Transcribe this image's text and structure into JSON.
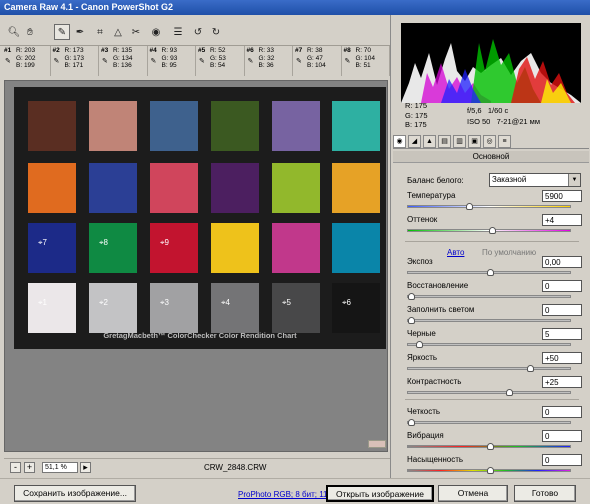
{
  "window": {
    "title": "Camera Raw 4.1  -  Canon PowerShot G2"
  },
  "toolbar": {
    "tools": [
      {
        "name": "zoom-tool-icon",
        "glyph": "🔍︎",
        "active": false
      },
      {
        "name": "hand-tool-icon",
        "glyph": "✋︎",
        "active": false
      },
      {
        "name": "white-balance-tool-icon",
        "glyph": "✎",
        "active": true
      },
      {
        "name": "color-sampler-tool-icon",
        "glyph": "✒",
        "active": false
      },
      {
        "name": "crop-tool-icon",
        "glyph": "⌗",
        "active": false
      },
      {
        "name": "straighten-tool-icon",
        "glyph": "△",
        "active": false
      },
      {
        "name": "retouch-tool-icon",
        "glyph": "✂",
        "active": false
      },
      {
        "name": "red-eye-tool-icon",
        "glyph": "◉",
        "active": false
      },
      {
        "name": "preferences-icon",
        "glyph": "☰",
        "active": false
      },
      {
        "name": "rotate-left-icon",
        "glyph": "↺",
        "active": false
      },
      {
        "name": "rotate-right-icon",
        "glyph": "↻",
        "active": false
      }
    ]
  },
  "samplers": [
    {
      "num": "#1",
      "r": "R: 203",
      "g": "G: 202",
      "b": "B: 199"
    },
    {
      "num": "#2",
      "r": "R: 173",
      "g": "G: 173",
      "b": "B: 171"
    },
    {
      "num": "#3",
      "r": "R: 135",
      "g": "G: 134",
      "b": "B: 136"
    },
    {
      "num": "#4",
      "r": "R:  93",
      "g": "G:  93",
      "b": "B:  95"
    },
    {
      "num": "#5",
      "r": "R:  52",
      "g": "G:  53",
      "b": "B:  54"
    },
    {
      "num": "#6",
      "r": "R:  33",
      "g": "G:  32",
      "b": "B:  36"
    },
    {
      "num": "#7",
      "r": "R:  38",
      "g": "G:  47",
      "b": "B: 104"
    },
    {
      "num": "#8",
      "r": "R:  70",
      "g": "G: 104",
      "b": "B:  51"
    }
  ],
  "chart": {
    "caption": "GretagMacbeth™ ColorChecker Color Rendition Chart",
    "rows": [
      [
        "#5a2e22",
        "#c08477",
        "#3e618d",
        "#3b5921",
        "#7763a1",
        "#2eb0a2"
      ],
      [
        "#e06b1f",
        "#2b3f95",
        "#d0455c",
        "#4c1f60",
        "#92b82c",
        "#e6a226"
      ],
      [
        "#1c2a88",
        "#0f8a43",
        "#c2142f",
        "#eec21b",
        "#c1388b",
        "#0a85a9"
      ],
      [
        "#ebe7e9",
        "#c3c3c5",
        "#a1a1a3",
        "#747476",
        "#484849",
        "#151515"
      ]
    ],
    "markers": [
      {
        "label": "7",
        "row": 2,
        "col": 0
      },
      {
        "label": "8",
        "row": 2,
        "col": 1
      },
      {
        "label": "9",
        "row": 2,
        "col": 2
      },
      {
        "label": "1",
        "row": 3,
        "col": 0
      },
      {
        "label": "2",
        "row": 3,
        "col": 1
      },
      {
        "label": "3",
        "row": 3,
        "col": 2
      },
      {
        "label": "4",
        "row": 3,
        "col": 3
      },
      {
        "label": "5",
        "row": 3,
        "col": 4
      },
      {
        "label": "6",
        "row": 3,
        "col": 5
      }
    ]
  },
  "status": {
    "zoom": "51,1 %",
    "zoom_out": "-",
    "zoom_in": "+",
    "zoom_menu": "▸",
    "filename": "CRW_2848.CRW"
  },
  "bottom": {
    "save": "Сохранить изображение...",
    "workflow": "ProPhoto RGB; 8 бит; 11",
    "open": "Открыть изображение",
    "cancel": "Отмена",
    "done": "Готово"
  },
  "readout": {
    "r": "R:  175",
    "g": "G:  175",
    "b": "B:  175"
  },
  "camera": {
    "aperture": "f/5,6",
    "shutter": "1/60 c",
    "iso": "ISO 50",
    "focal": "7-21@21 мм"
  },
  "panel": {
    "title": "Основной",
    "wb_label": "Баланс белого:",
    "wb_value": "Заказной",
    "auto": "Авто",
    "default": "По умолчанию",
    "sliders": [
      {
        "id": "temperature",
        "label": "Температура",
        "value": "5900",
        "level": 0.37
      },
      {
        "id": "tint",
        "label": "Оттенок",
        "value": "+4",
        "level": 0.51
      },
      {
        "id": "exposure",
        "label": "Экспоз",
        "value": "0,00",
        "level": 0.5
      },
      {
        "id": "recovery",
        "label": "Восстановление",
        "value": "0",
        "level": 0.0
      },
      {
        "id": "fill-light",
        "label": "Заполнить светом",
        "value": "0",
        "level": 0.0
      },
      {
        "id": "blacks",
        "label": "Черные",
        "value": "5",
        "level": 0.05
      },
      {
        "id": "brightness",
        "label": "Яркость",
        "value": "+50",
        "level": 0.75
      },
      {
        "id": "contrast",
        "label": "Контрастность",
        "value": "+25",
        "level": 0.62
      },
      {
        "id": "clarity",
        "label": "Четкость",
        "value": "0",
        "level": 0.0
      },
      {
        "id": "vibrance",
        "label": "Вибрация",
        "value": "0",
        "level": 0.5
      },
      {
        "id": "saturation",
        "label": "Насыщенность",
        "value": "0",
        "level": 0.5
      }
    ]
  },
  "colors": {
    "title_bar": "#1f4fa8",
    "link": "#0000cc"
  }
}
